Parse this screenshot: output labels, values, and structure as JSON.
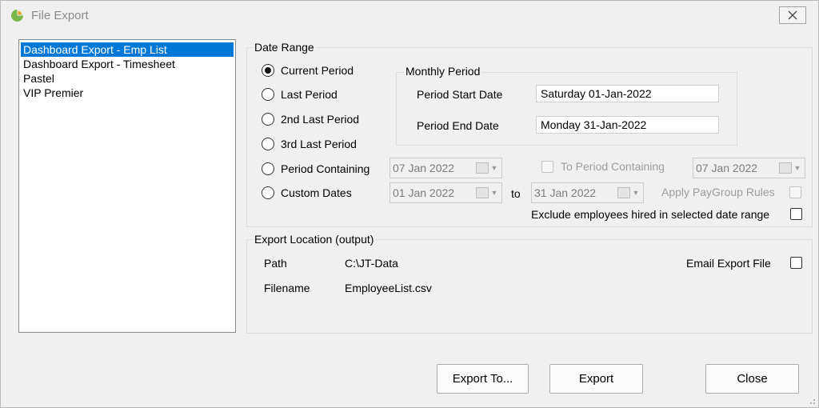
{
  "window": {
    "title": "File Export"
  },
  "export_list": {
    "items": [
      {
        "label": "Dashboard Export - Emp List",
        "selected": true
      },
      {
        "label": "Dashboard Export - Timesheet",
        "selected": false
      },
      {
        "label": "Pastel",
        "selected": false
      },
      {
        "label": "VIP Premier",
        "selected": false
      }
    ]
  },
  "date_range": {
    "legend": "Date Range",
    "radios": [
      {
        "label": "Current Period",
        "checked": true
      },
      {
        "label": "Last Period",
        "checked": false
      },
      {
        "label": "2nd Last Period",
        "checked": false
      },
      {
        "label": "3rd Last Period",
        "checked": false
      },
      {
        "label": "Period Containing",
        "checked": false
      },
      {
        "label": "Custom Dates",
        "checked": false
      }
    ],
    "monthly_period": {
      "legend": "Monthly Period",
      "start_label": "Period Start Date",
      "start_value": "Saturday  01-Jan-2022",
      "end_label": "Period End Date",
      "end_value": "Monday  31-Jan-2022"
    },
    "period_containing_date": "07 Jan  2022",
    "to_period_containing_label": "To Period Containing",
    "to_period_containing_date": "07 Jan  2022",
    "custom_from_date": "01 Jan  2022",
    "to_label": "to",
    "custom_to_date": "31 Jan  2022",
    "apply_paygroup_label": "Apply PayGroup Rules",
    "exclude_label": "Exclude employees hired in selected date range"
  },
  "export_location": {
    "legend": "Export Location (output)",
    "path_label": "Path",
    "path_value": "C:\\JT-Data",
    "filename_label": "Filename",
    "filename_value": "EmployeeList.csv",
    "email_label": "Email Export File"
  },
  "buttons": {
    "export_to": "Export To...",
    "export": "Export",
    "close": "Close"
  }
}
